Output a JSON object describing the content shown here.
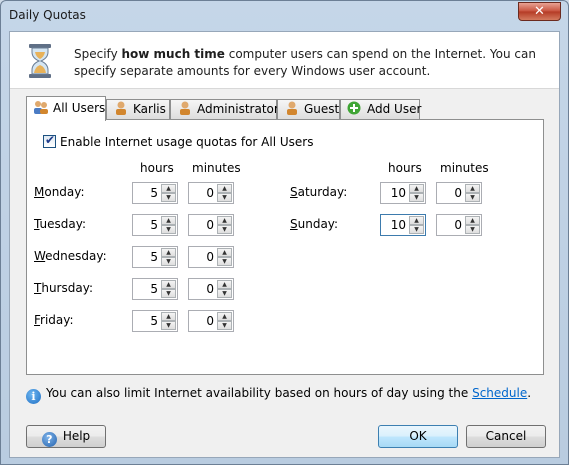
{
  "window": {
    "title": "Daily Quotas",
    "close_glyph": "✕"
  },
  "header": {
    "intro_pre": "Specify ",
    "intro_bold": "how much time",
    "intro_post": " computer users can spend on the Internet. You can specify separate amounts for every Windows user account.",
    "icon": "hourglass-icon"
  },
  "tabs": [
    {
      "label": "All Users",
      "icon": "users-icon",
      "active": true
    },
    {
      "label": "Karlis",
      "icon": "user-icon",
      "active": false
    },
    {
      "label": "Administrator",
      "icon": "user-icon",
      "active": false
    },
    {
      "label": "Guest",
      "icon": "user-icon",
      "active": false
    },
    {
      "label": "Add User",
      "icon": "add-icon",
      "active": false
    }
  ],
  "panel": {
    "enable_label": "Enable Internet usage quotas for All Users",
    "enable_checked": true,
    "col_hours": "hours",
    "col_minutes": "minutes",
    "days_left": [
      {
        "name": "Monday",
        "accel": "M",
        "rest": "onday:",
        "hours": "5",
        "minutes": "0"
      },
      {
        "name": "Tuesday",
        "accel": "T",
        "rest": "uesday:",
        "hours": "5",
        "minutes": "0"
      },
      {
        "name": "Wednesday",
        "accel": "W",
        "rest": "ednesday:",
        "hours": "5",
        "minutes": "0"
      },
      {
        "name": "Thursday",
        "accel": "T",
        "rest": "hursday:",
        "hours": "5",
        "minutes": "0"
      },
      {
        "name": "Friday",
        "accel": "F",
        "rest": "riday:",
        "hours": "5",
        "minutes": "0"
      }
    ],
    "days_right": [
      {
        "name": "Saturday",
        "accel": "S",
        "rest": "aturday:",
        "hours": "10",
        "minutes": "0"
      },
      {
        "name": "Sunday",
        "accel": "S",
        "rest": "unday:",
        "hours": "10",
        "minutes": "0"
      }
    ]
  },
  "info": {
    "text": "You can also limit Internet availability based on hours of day using the ",
    "link": "Schedule",
    "suffix": "."
  },
  "buttons": {
    "help": "Help",
    "ok": "OK",
    "cancel": "Cancel"
  },
  "colors": {
    "link": "#0066cc",
    "accent": "#3c7fb1",
    "close": "#c7513c"
  }
}
